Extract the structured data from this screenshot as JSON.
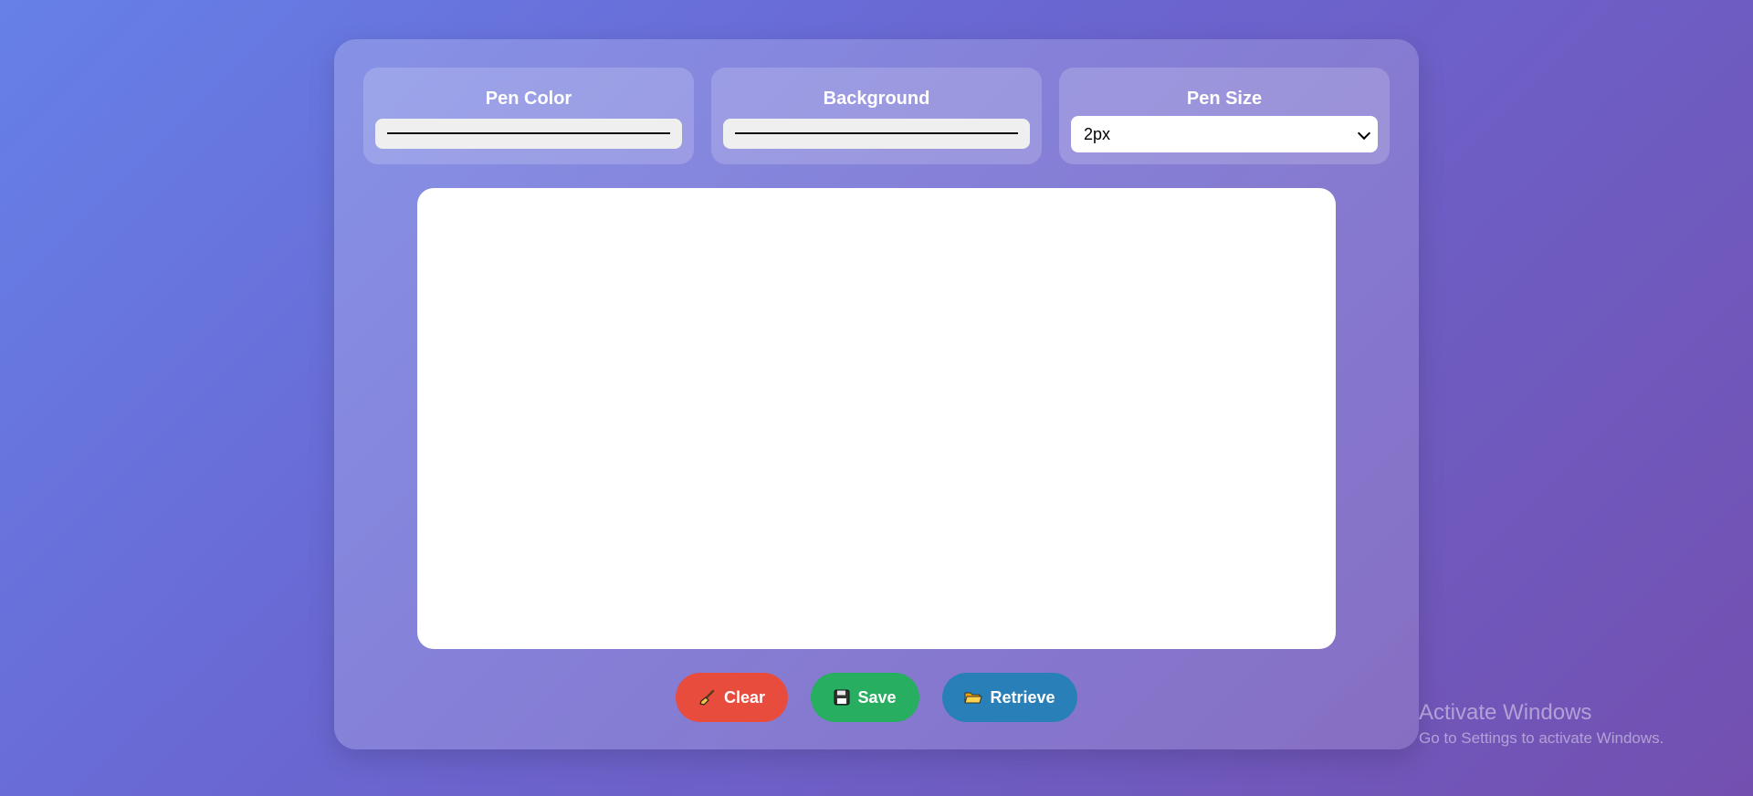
{
  "controls": {
    "pen_color": {
      "label": "Pen Color",
      "value": "#000000"
    },
    "background": {
      "label": "Background",
      "value": "#ffffff"
    },
    "pen_size": {
      "label": "Pen Size",
      "selected": "2px"
    }
  },
  "buttons": {
    "clear": {
      "label": "Clear",
      "icon": "broom-icon",
      "color": "#e74c3c"
    },
    "save": {
      "label": "Save",
      "icon": "floppy-disk-icon",
      "color": "#27ae60"
    },
    "retrieve": {
      "label": "Retrieve",
      "icon": "folder-icon",
      "color": "#2980b9"
    }
  },
  "watermark": {
    "title": "Activate Windows",
    "subtitle": "Go to Settings to activate Windows."
  }
}
